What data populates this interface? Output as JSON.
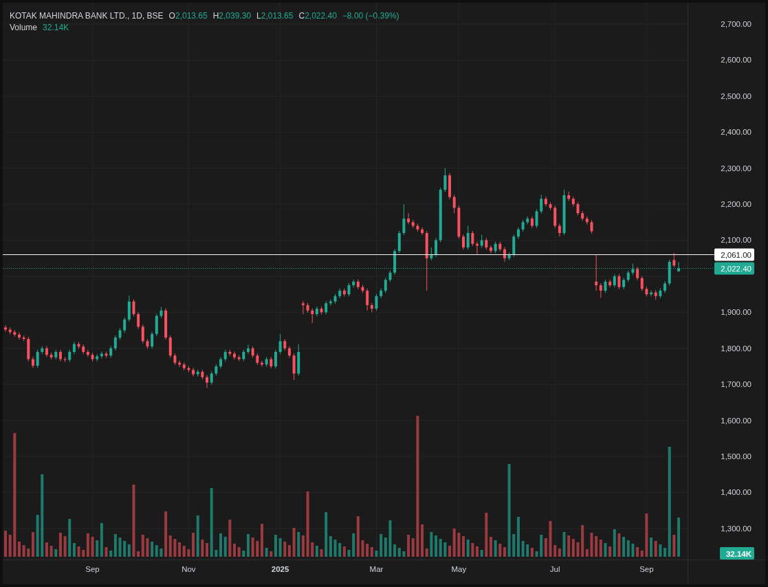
{
  "legend": {
    "title": "KOTAK MAHINDRA BANK LTD., 1D, BSE",
    "fields": [
      {
        "label": "O",
        "value": "2,013.65"
      },
      {
        "label": "H",
        "value": "2,039.30"
      },
      {
        "label": "L",
        "value": "2,013.65"
      },
      {
        "label": "C",
        "value": "2,022.40"
      }
    ],
    "change": "−8.00 (−0.39%)",
    "volume_label": "Volume",
    "volume_value": "32.14K"
  },
  "chart": {
    "chart_data": {
      "type": "candlestick",
      "yticks": [
        {
          "value": 1300,
          "label": "1,300.00"
        },
        {
          "value": 1400,
          "label": "1,400.00"
        },
        {
          "value": 1500,
          "label": "1,500.00"
        },
        {
          "value": 1600,
          "label": "1,600.00"
        },
        {
          "value": 1700,
          "label": "1,700.00"
        },
        {
          "value": 1800,
          "label": "1,800.00"
        },
        {
          "value": 1900,
          "label": "1,900.00"
        },
        {
          "value": 2100,
          "label": "2,100.00"
        },
        {
          "value": 2200,
          "label": "2,200.00"
        },
        {
          "value": 2300,
          "label": "2,300.00"
        },
        {
          "value": 2400,
          "label": "2,400.00"
        },
        {
          "value": 2500,
          "label": "2,500.00"
        },
        {
          "value": 2600,
          "label": "2,600.00"
        },
        {
          "value": 2700,
          "label": "2,700.00"
        }
      ],
      "ylim": [
        1214,
        2759
      ],
      "categories": [
        null,
        null,
        null,
        null,
        null,
        null,
        null,
        null,
        null,
        null,
        null,
        null,
        null,
        null,
        null,
        null,
        null,
        null,
        null,
        "Sep",
        null,
        null,
        null,
        null,
        null,
        null,
        null,
        null,
        null,
        null,
        null,
        null,
        null,
        null,
        null,
        null,
        null,
        null,
        null,
        null,
        "Nov",
        null,
        null,
        null,
        null,
        null,
        null,
        null,
        null,
        null,
        null,
        null,
        null,
        null,
        null,
        null,
        null,
        null,
        null,
        null,
        "2025",
        null,
        null,
        null,
        null,
        null,
        null,
        null,
        null,
        null,
        null,
        null,
        null,
        null,
        null,
        null,
        null,
        null,
        null,
        null,
        null,
        "Mar",
        null,
        null,
        null,
        null,
        null,
        null,
        null,
        null,
        null,
        null,
        null,
        null,
        null,
        null,
        null,
        null,
        null,
        "May",
        null,
        null,
        null,
        null,
        null,
        null,
        null,
        null,
        null,
        null,
        null,
        null,
        null,
        null,
        null,
        null,
        null,
        null,
        null,
        null,
        "Jul",
        null,
        null,
        null,
        null,
        null,
        null,
        null,
        null,
        null,
        null,
        null,
        null,
        null,
        null,
        null,
        null,
        null,
        null,
        null,
        "Sep",
        null,
        null,
        null,
        null,
        null,
        null,
        null
      ],
      "ohlc": [
        [
          1858,
          1864,
          1846,
          1852
        ],
        [
          1852,
          1858,
          1839,
          1845
        ],
        [
          1845,
          1851,
          1832,
          1838
        ],
        [
          1838,
          1844,
          1824,
          1830
        ],
        [
          1830,
          1836,
          1820,
          1826
        ],
        [
          1826,
          1832,
          1764,
          1770
        ],
        [
          1770,
          1776,
          1746,
          1752
        ],
        [
          1752,
          1796,
          1746,
          1790
        ],
        [
          1790,
          1806,
          1784,
          1800
        ],
        [
          1800,
          1806,
          1776,
          1782
        ],
        [
          1782,
          1788,
          1769,
          1775
        ],
        [
          1775,
          1796,
          1769,
          1790
        ],
        [
          1790,
          1796,
          1764,
          1770
        ],
        [
          1770,
          1776,
          1762,
          1768
        ],
        [
          1768,
          1796,
          1762,
          1790
        ],
        [
          1790,
          1818,
          1784,
          1812
        ],
        [
          1812,
          1818,
          1799,
          1805
        ],
        [
          1805,
          1811,
          1784,
          1790
        ],
        [
          1790,
          1796,
          1776,
          1782
        ],
        [
          1782,
          1788,
          1764,
          1770
        ],
        [
          1770,
          1784,
          1764,
          1778
        ],
        [
          1778,
          1791,
          1772,
          1785
        ],
        [
          1785,
          1791,
          1774,
          1780
        ],
        [
          1780,
          1806,
          1774,
          1800
        ],
        [
          1800,
          1836,
          1794,
          1830
        ],
        [
          1830,
          1856,
          1824,
          1850
        ],
        [
          1850,
          1886,
          1844,
          1880
        ],
        [
          1880,
          1946,
          1874,
          1930
        ],
        [
          1930,
          1936,
          1889,
          1895
        ],
        [
          1895,
          1901,
          1854,
          1860
        ],
        [
          1860,
          1866,
          1814,
          1820
        ],
        [
          1820,
          1826,
          1799,
          1805
        ],
        [
          1805,
          1846,
          1799,
          1840
        ],
        [
          1840,
          1896,
          1834,
          1890
        ],
        [
          1890,
          1915,
          1884,
          1905
        ],
        [
          1905,
          1911,
          1824,
          1830
        ],
        [
          1830,
          1836,
          1774,
          1780
        ],
        [
          1780,
          1786,
          1754,
          1760
        ],
        [
          1760,
          1766,
          1749,
          1755
        ],
        [
          1755,
          1761,
          1739,
          1745
        ],
        [
          1745,
          1751,
          1734,
          1740
        ],
        [
          1740,
          1746,
          1722,
          1728
        ],
        [
          1728,
          1741,
          1722,
          1735
        ],
        [
          1735,
          1741,
          1714,
          1720
        ],
        [
          1720,
          1726,
          1690,
          1705
        ],
        [
          1705,
          1736,
          1699,
          1730
        ],
        [
          1730,
          1756,
          1724,
          1750
        ],
        [
          1750,
          1776,
          1744,
          1770
        ],
        [
          1770,
          1796,
          1764,
          1790
        ],
        [
          1790,
          1796,
          1779,
          1785
        ],
        [
          1785,
          1791,
          1769,
          1775
        ],
        [
          1775,
          1781,
          1764,
          1770
        ],
        [
          1770,
          1796,
          1764,
          1790
        ],
        [
          1790,
          1810,
          1784,
          1800
        ],
        [
          1800,
          1806,
          1774,
          1780
        ],
        [
          1780,
          1786,
          1754,
          1760
        ],
        [
          1760,
          1766,
          1749,
          1755
        ],
        [
          1755,
          1776,
          1749,
          1770
        ],
        [
          1770,
          1776,
          1744,
          1750
        ],
        [
          1750,
          1796,
          1744,
          1790
        ],
        [
          1790,
          1840,
          1784,
          1820
        ],
        [
          1820,
          1826,
          1794,
          1800
        ],
        [
          1800,
          1806,
          1774,
          1780
        ],
        [
          1780,
          1786,
          1712,
          1730
        ],
        [
          1730,
          1812,
          1724,
          1790
        ],
        [
          1925,
          1931,
          1895,
          1920
        ],
        [
          1920,
          1926,
          1899,
          1905
        ],
        [
          1905,
          1911,
          1870,
          1895
        ],
        [
          1895,
          1916,
          1889,
          1910
        ],
        [
          1910,
          1916,
          1894,
          1900
        ],
        [
          1900,
          1931,
          1894,
          1925
        ],
        [
          1925,
          1936,
          1919,
          1930
        ],
        [
          1930,
          1951,
          1924,
          1945
        ],
        [
          1945,
          1966,
          1939,
          1960
        ],
        [
          1960,
          1966,
          1944,
          1950
        ],
        [
          1950,
          1981,
          1944,
          1975
        ],
        [
          1975,
          1991,
          1969,
          1985
        ],
        [
          1985,
          1991,
          1964,
          1970
        ],
        [
          1970,
          1976,
          1954,
          1960
        ],
        [
          1960,
          1966,
          1905,
          1920
        ],
        [
          1920,
          1926,
          1900,
          1910
        ],
        [
          1910,
          1951,
          1904,
          1945
        ],
        [
          1945,
          1966,
          1939,
          1960
        ],
        [
          1960,
          1996,
          1954,
          1990
        ],
        [
          1990,
          2016,
          1984,
          2010
        ],
        [
          2010,
          2076,
          2004,
          2070
        ],
        [
          2070,
          2126,
          2064,
          2120
        ],
        [
          2120,
          2200,
          2114,
          2160
        ],
        [
          2160,
          2175,
          2144,
          2150
        ],
        [
          2150,
          2156,
          2134,
          2140
        ],
        [
          2140,
          2146,
          2124,
          2130
        ],
        [
          2130,
          2136,
          2114,
          2120
        ],
        [
          2120,
          2126,
          1960,
          2050
        ],
        [
          2050,
          2080,
          2044,
          2060
        ],
        [
          2060,
          2106,
          2054,
          2100
        ],
        [
          2100,
          2246,
          2094,
          2240
        ],
        [
          2240,
          2300,
          2234,
          2280
        ],
        [
          2280,
          2286,
          2214,
          2220
        ],
        [
          2220,
          2226,
          2175,
          2190
        ],
        [
          2190,
          2196,
          2104,
          2110
        ],
        [
          2110,
          2116,
          2074,
          2080
        ],
        [
          2080,
          2140,
          2074,
          2120
        ],
        [
          2120,
          2126,
          2084,
          2090
        ],
        [
          2090,
          2096,
          2060,
          2085
        ],
        [
          2085,
          2115,
          2079,
          2100
        ],
        [
          2100,
          2106,
          2074,
          2080
        ],
        [
          2080,
          2086,
          2064,
          2070
        ],
        [
          2070,
          2096,
          2064,
          2090
        ],
        [
          2090,
          2096,
          2069,
          2075
        ],
        [
          2075,
          2081,
          2040,
          2050
        ],
        [
          2050,
          2066,
          2044,
          2060
        ],
        [
          2060,
          2116,
          2054,
          2110
        ],
        [
          2110,
          2136,
          2104,
          2130
        ],
        [
          2130,
          2156,
          2124,
          2150
        ],
        [
          2150,
          2166,
          2144,
          2160
        ],
        [
          2160,
          2166,
          2134,
          2140
        ],
        [
          2140,
          2186,
          2134,
          2180
        ],
        [
          2180,
          2226,
          2174,
          2215
        ],
        [
          2215,
          2221,
          2194,
          2200
        ],
        [
          2200,
          2206,
          2184,
          2190
        ],
        [
          2190,
          2196,
          2134,
          2140
        ],
        [
          2140,
          2146,
          2110,
          2120
        ],
        [
          2120,
          2240,
          2114,
          2225
        ],
        [
          2225,
          2235,
          2209,
          2215
        ],
        [
          2215,
          2221,
          2194,
          2200
        ],
        [
          2200,
          2206,
          2169,
          2175
        ],
        [
          2175,
          2181,
          2154,
          2160
        ],
        [
          2160,
          2166,
          2144,
          2150
        ],
        [
          2150,
          2156,
          2119,
          2125
        ],
        [
          1985,
          2060,
          1960,
          1975
        ],
        [
          1975,
          1981,
          1940,
          1960
        ],
        [
          1960,
          1991,
          1954,
          1985
        ],
        [
          1985,
          1991,
          1969,
          1975
        ],
        [
          1975,
          2006,
          1969,
          2000
        ],
        [
          2000,
          2006,
          1964,
          1970
        ],
        [
          1970,
          1996,
          1964,
          1990
        ],
        [
          1990,
          2016,
          1984,
          2010
        ],
        [
          2010,
          2035,
          2004,
          2020
        ],
        [
          2020,
          2026,
          1989,
          1995
        ],
        [
          1995,
          2001,
          1959,
          1965
        ],
        [
          1965,
          1971,
          1944,
          1950
        ],
        [
          1950,
          1961,
          1944,
          1955
        ],
        [
          1955,
          1961,
          1935,
          1945
        ],
        [
          1945,
          1966,
          1939,
          1960
        ],
        [
          1960,
          1986,
          1954,
          1980
        ],
        [
          1980,
          2046,
          1974,
          2040
        ],
        [
          2045,
          2065,
          2025,
          2030
        ],
        [
          2013.65,
          2039.3,
          2013.65,
          2022.4
        ]
      ],
      "grid": true,
      "ref_lines": [
        {
          "axis": "y",
          "value": 2061,
          "label": "2,061.00",
          "color": "#ffffff"
        },
        {
          "axis": "y",
          "value": 2022.4,
          "label": "2,022.40",
          "color": "#22ab94"
        }
      ]
    },
    "volume_badge": "32.14K"
  }
}
